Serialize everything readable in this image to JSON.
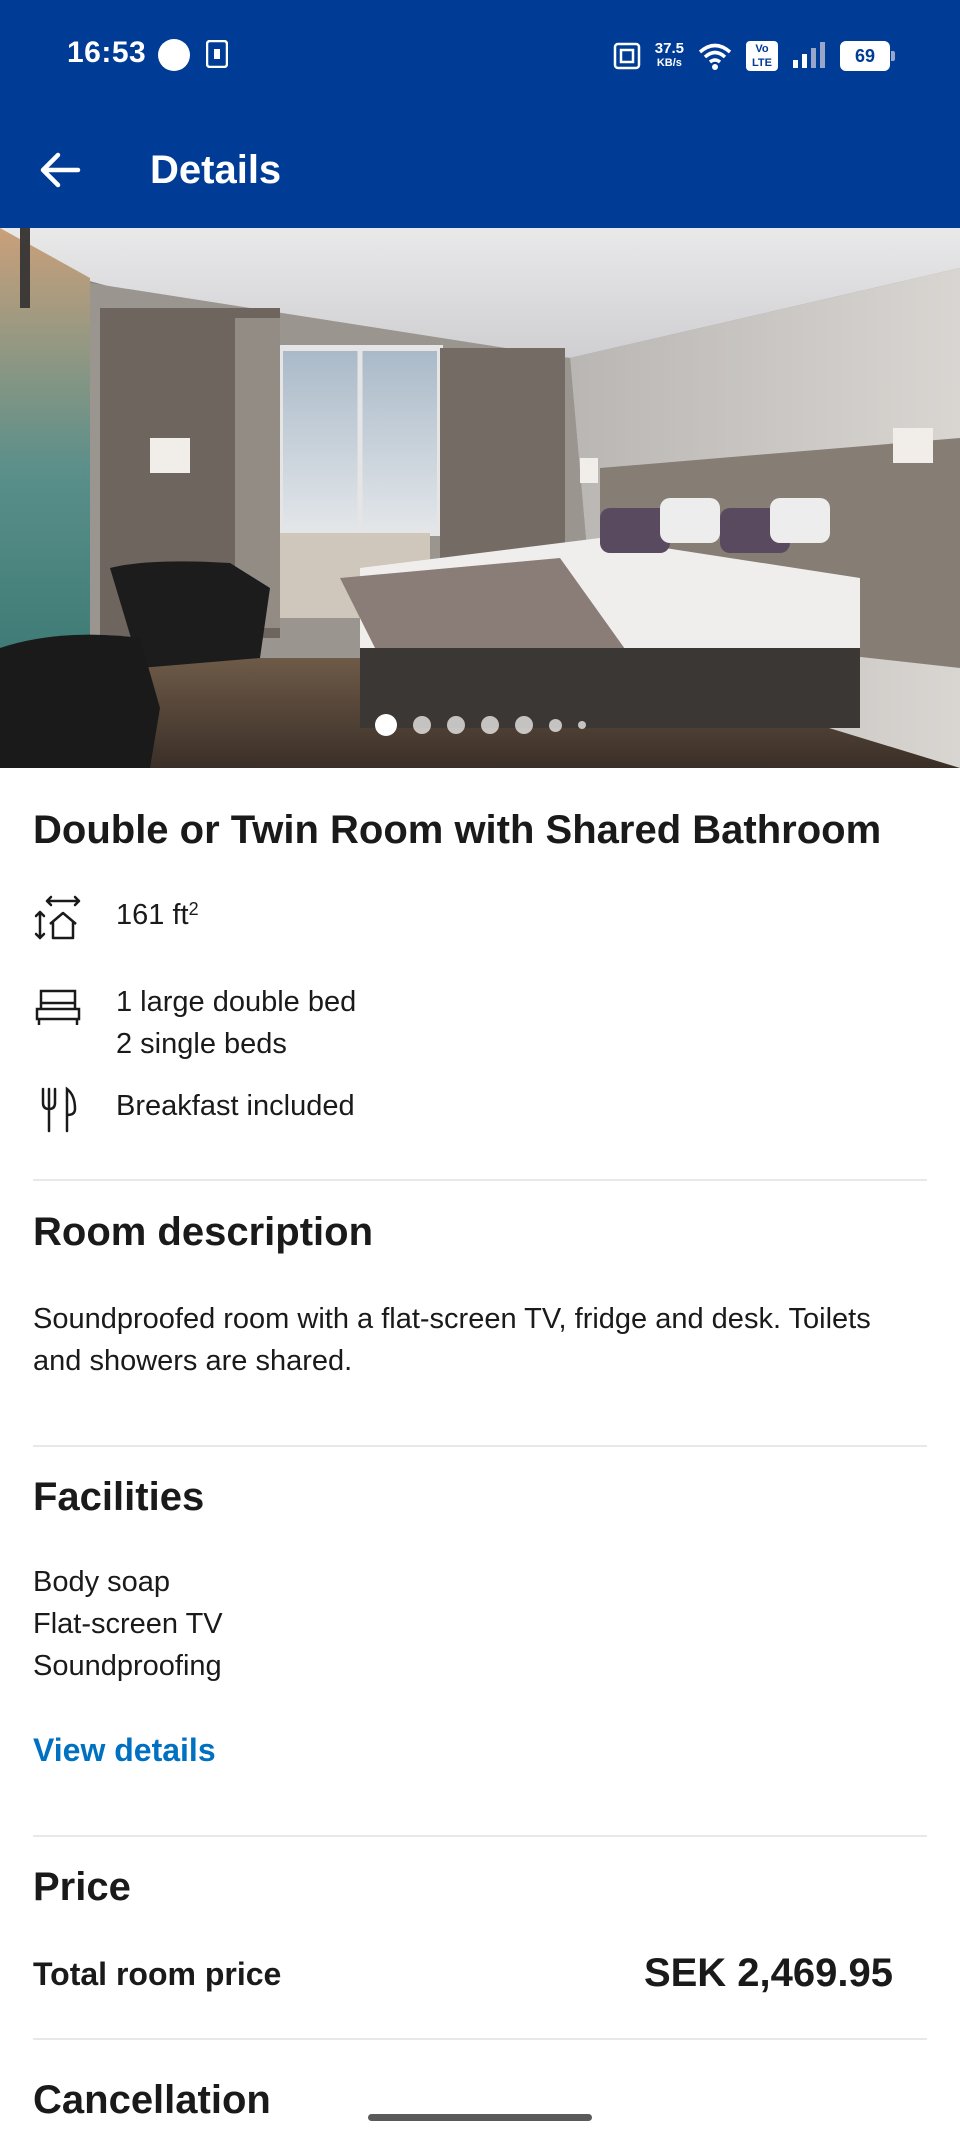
{
  "status_bar": {
    "time": "16:53",
    "net_speed": "37.5",
    "net_unit": "KB/s",
    "volte": "Vo LTE",
    "battery": "69"
  },
  "app_bar": {
    "title": "Details",
    "back_icon": "arrow-left-icon"
  },
  "gallery": {
    "image_alt": "Hotel room photo",
    "page_count": 7,
    "active_index": 0
  },
  "room": {
    "name": "Double or Twin Room with Shared Bathroom",
    "size_value": "161 ft",
    "size_sup": "2",
    "beds": [
      "1 large double bed",
      "2 single beds"
    ],
    "meal": "Breakfast included"
  },
  "description": {
    "heading": "Room description",
    "text": "Soundproofed room with a flat-screen TV, fridge and desk. Toilets and showers are shared."
  },
  "facilities": {
    "heading": "Facilities",
    "items": [
      "Body soap",
      "Flat-screen TV",
      "Soundproofing"
    ],
    "link": "View details"
  },
  "price": {
    "heading": "Price",
    "label": "Total room price",
    "value": "SEK 2,469.95"
  },
  "cancellation": {
    "heading": "Cancellation"
  },
  "colors": {
    "brand_blue": "#003b95",
    "link_blue": "#0071c2"
  }
}
